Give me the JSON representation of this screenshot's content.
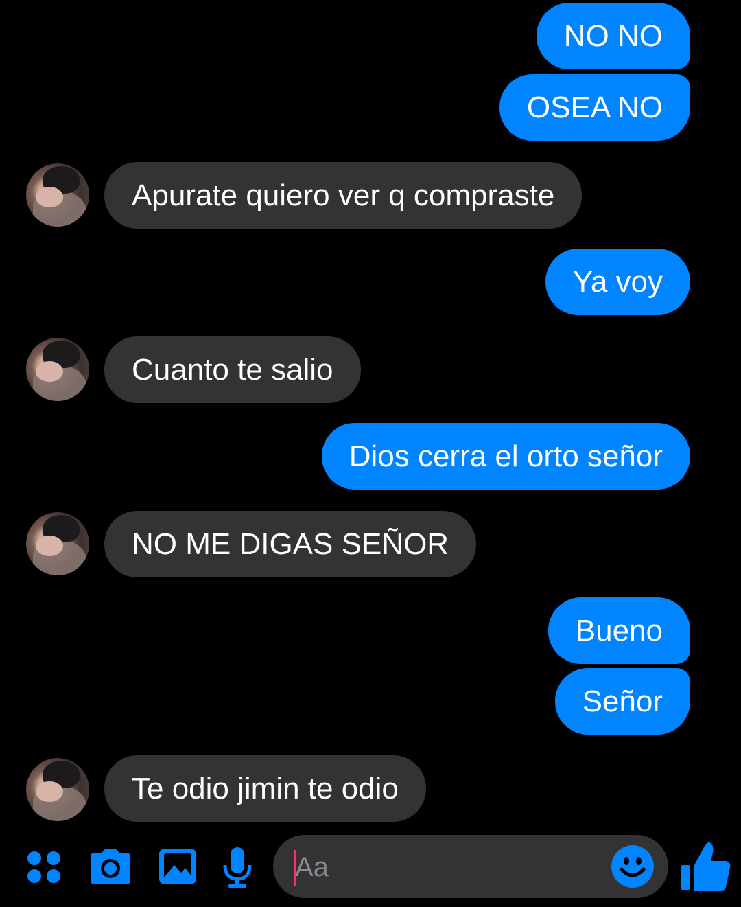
{
  "messages": [
    {
      "text": "NO NO",
      "from": "me"
    },
    {
      "text": "OSEA NO",
      "from": "me"
    },
    {
      "text": "Apurate quiero ver q compraste",
      "from": "them"
    },
    {
      "text": "Ya voy",
      "from": "me"
    },
    {
      "text": "Cuanto te salio",
      "from": "them"
    },
    {
      "text": "Dios cerra el orto señor",
      "from": "me"
    },
    {
      "text": "NO ME DIGAS SEÑOR",
      "from": "them"
    },
    {
      "text": "Bueno",
      "from": "me"
    },
    {
      "text": "Señor",
      "from": "me"
    },
    {
      "text": "Te odio jimin te odio",
      "from": "them"
    }
  ],
  "composer": {
    "placeholder": "Aa",
    "value": "",
    "icons": [
      "apps-icon",
      "camera-icon",
      "gallery-icon",
      "microphone-icon",
      "emoji-icon",
      "thumbs-up-icon"
    ]
  },
  "colors": {
    "background": "#000000",
    "outgoing_bubble": "#0084ff",
    "incoming_bubble": "#333335",
    "icon_accent": "#0084ff",
    "caret": "#ff2d6f"
  }
}
